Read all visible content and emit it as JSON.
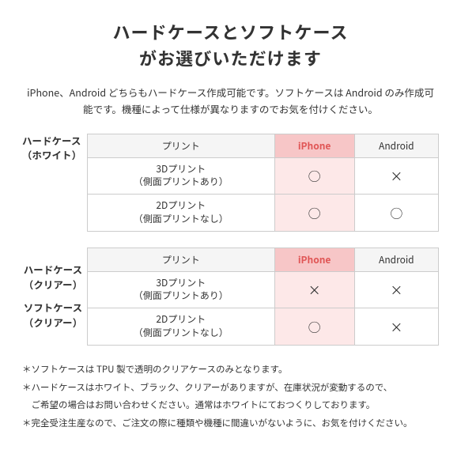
{
  "title": {
    "line1": "ハードケースとソフトケース",
    "line2": "がお選びいただけます"
  },
  "subtitle": "iPhone、Android どちらもハードケース作成可能です。ソフトケースは\nAndroid のみ作成可能です。機種によって仕様が異なりますのでお気を付けください。",
  "table1": {
    "section_label": "ハードケース\n（ホワイト）",
    "headers": [
      "プリント",
      "iPhone",
      "Android"
    ],
    "rows": [
      {
        "label": "3Dプリント\n（側面プリントあり）",
        "iphone": "○",
        "android": "×"
      },
      {
        "label": "2Dプリント\n（側面プリントなし）",
        "iphone": "○",
        "android": "○"
      }
    ]
  },
  "table2": {
    "section_label1": "ハードケース\n（クリアー）",
    "section_label2": "ソフトケース\n（クリアー）",
    "headers": [
      "プリント",
      "iPhone",
      "Android"
    ],
    "rows": [
      {
        "label": "3Dプリント\n（側面プリントあり）",
        "iphone": "×",
        "android": "×"
      },
      {
        "label": "2Dプリント\n（側面プリントなし）",
        "iphone": "○",
        "android": "×"
      }
    ]
  },
  "notes": [
    "＊ソフトケースは TPU 製で透明のクリアケースのみとなります。",
    "＊ハードケースはホワイト、ブラック、クリアーがありますが、在庫状況が変動するので、",
    "　ご希望の場合はお問い合わせください。通常はホワイトにておつくりしております。",
    "＊完全受注生産なので、ご注文の際に種類や機種に間違いがないように、お気を付けください。"
  ],
  "colors": {
    "iphone_header_bg": "#f7c6c7",
    "iphone_header_text": "#e05555",
    "iphone_cell_bg": "#fde8e8",
    "table_border": "#ccc",
    "header_bg": "#f5f5f5"
  }
}
